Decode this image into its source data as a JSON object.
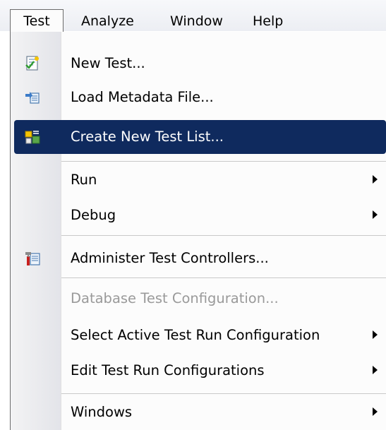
{
  "menubar": {
    "items": [
      {
        "label": "Test"
      },
      {
        "label": "Analyze"
      },
      {
        "label": "Window"
      },
      {
        "label": "Help"
      }
    ]
  },
  "menu": {
    "items": [
      {
        "label": "New Test...",
        "icon": "new-test-icon"
      },
      {
        "label": "Load Metadata File...",
        "icon": "load-metadata-icon"
      },
      {
        "label": "Create New Test List...",
        "icon": "test-list-icon",
        "highlighted": true
      },
      {
        "label": "Run",
        "submenu": true
      },
      {
        "label": "Debug",
        "submenu": true
      },
      {
        "label": "Administer Test Controllers...",
        "icon": "test-controllers-icon"
      },
      {
        "label": "Database Test Configuration...",
        "disabled": true
      },
      {
        "label": "Select Active Test Run Configuration",
        "submenu": true
      },
      {
        "label": "Edit Test Run Configurations",
        "submenu": true
      },
      {
        "label": "Windows",
        "submenu": true
      }
    ]
  },
  "colors": {
    "highlight": "#0f2a5e",
    "disabled_text": "#9a9a9a"
  }
}
